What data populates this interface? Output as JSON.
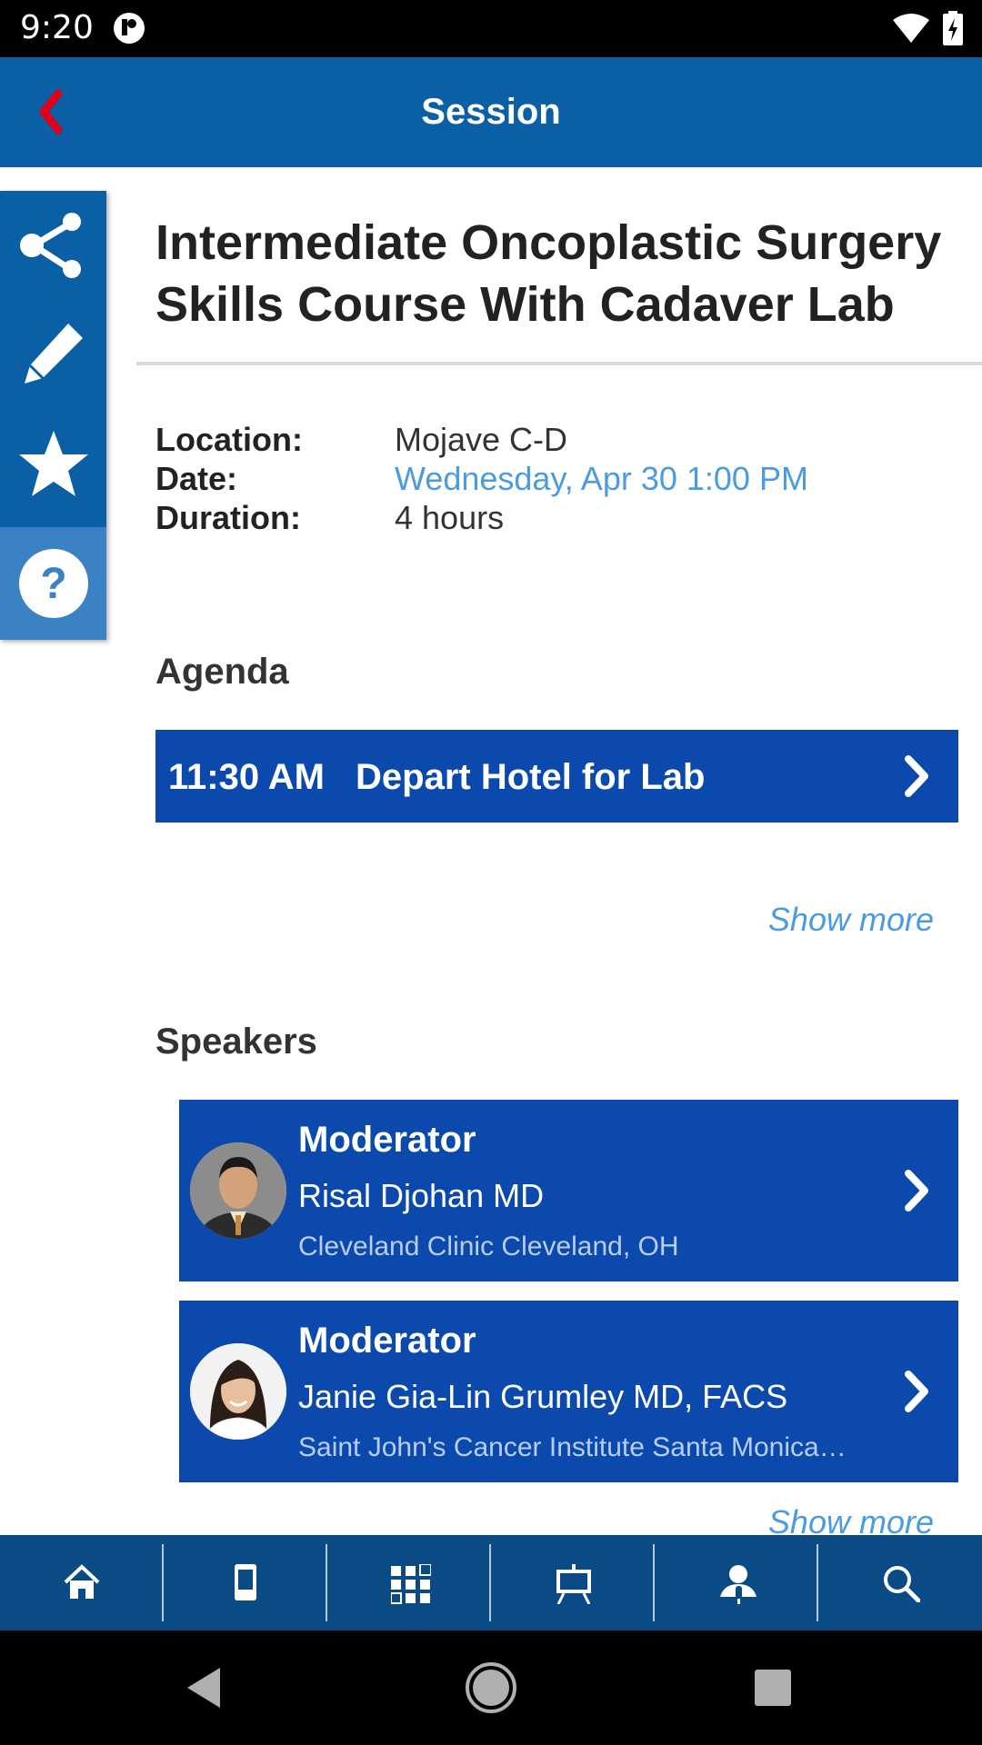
{
  "status_bar": {
    "time": "9:20"
  },
  "app_bar": {
    "title": "Session"
  },
  "session": {
    "title": "Intermediate Oncoplastic Surgery Skills Course With Cadaver Lab",
    "details": [
      {
        "label": "Location:",
        "value": "Mojave C-D"
      },
      {
        "label": "Date:",
        "value": "Wednesday, Apr 30 1:00 PM"
      },
      {
        "label": "Duration:",
        "value": "4 hours"
      }
    ]
  },
  "agenda": {
    "heading": "Agenda",
    "items": [
      {
        "time": "11:30 AM",
        "title": "Depart Hotel for Lab"
      }
    ],
    "show_more": "Show more"
  },
  "speakers": {
    "heading": "Speakers",
    "items": [
      {
        "role": "Moderator",
        "name": "Risal Djohan MD",
        "org": "Cleveland Clinic Cleveland, OH"
      },
      {
        "role": "Moderator",
        "name": "Janie Gia-Lin Grumley MD, FACS",
        "org": "Saint John's Cancer Institute Santa Monica, CA"
      }
    ],
    "show_more": "Show more"
  },
  "action_rail": [
    "share-icon",
    "pencil-icon",
    "star-icon",
    "help-icon"
  ],
  "bottom_nav": [
    "home-icon",
    "mobile-device-icon",
    "grid-schedule-icon",
    "presentation-icon",
    "speaker-icon",
    "search-icon"
  ],
  "colors": {
    "app_bar": "#0a5fa5",
    "card": "#0b4aac",
    "link": "#4a9be0",
    "back_arrow": "#e0001b",
    "bottom_nav": "#0a4a85"
  }
}
